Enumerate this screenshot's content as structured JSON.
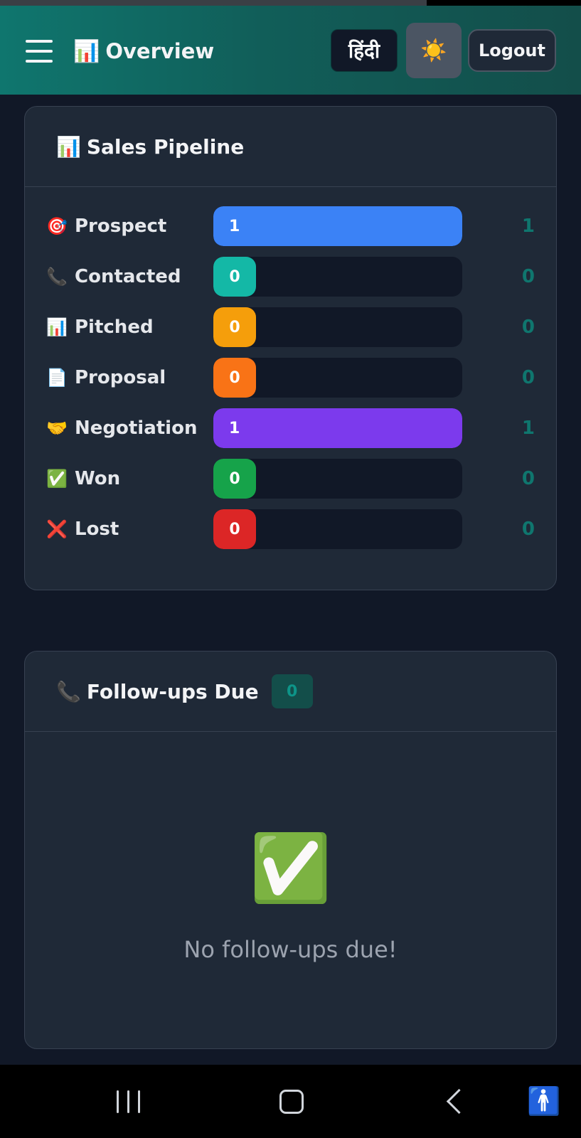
{
  "header": {
    "menu_icon": "hamburger-menu-icon",
    "title_icon": "📊",
    "title": "Overview",
    "language_button": "हिंदी",
    "theme_icon": "☀️",
    "logout_button": "Logout"
  },
  "pipeline": {
    "title_icon": "📊",
    "title": "Sales Pipeline",
    "stages": [
      {
        "icon": "🎯",
        "label": "Prospect",
        "value": "1",
        "count": "1",
        "fill_fraction": 1.0,
        "color": "#3b82f6"
      },
      {
        "icon": "📞",
        "label": "Contacted",
        "value": "0",
        "count": "0",
        "fill_fraction": 0,
        "color": "#14b8a6"
      },
      {
        "icon": "📊",
        "label": "Pitched",
        "value": "0",
        "count": "0",
        "fill_fraction": 0,
        "color": "#f59e0b"
      },
      {
        "icon": "📄",
        "label": "Proposal",
        "value": "0",
        "count": "0",
        "fill_fraction": 0,
        "color": "#f97316"
      },
      {
        "icon": "🤝",
        "label": "Negotiation",
        "value": "1",
        "count": "1",
        "fill_fraction": 1.0,
        "color": "#7c3aed"
      },
      {
        "icon": "✅",
        "label": "Won",
        "value": "0",
        "count": "0",
        "fill_fraction": 0,
        "color": "#16a34a"
      },
      {
        "icon": "❌",
        "label": "Lost",
        "value": "0",
        "count": "0",
        "fill_fraction": 0,
        "color": "#dc2626"
      }
    ]
  },
  "followups": {
    "title_icon": "📞",
    "title": "Follow-ups Due",
    "badge": "0",
    "empty_icon": "✅",
    "empty_text": "No follow-ups due!"
  },
  "colors": {
    "accent": "#0f766e",
    "background": "#111827",
    "card": "#1f2937"
  }
}
